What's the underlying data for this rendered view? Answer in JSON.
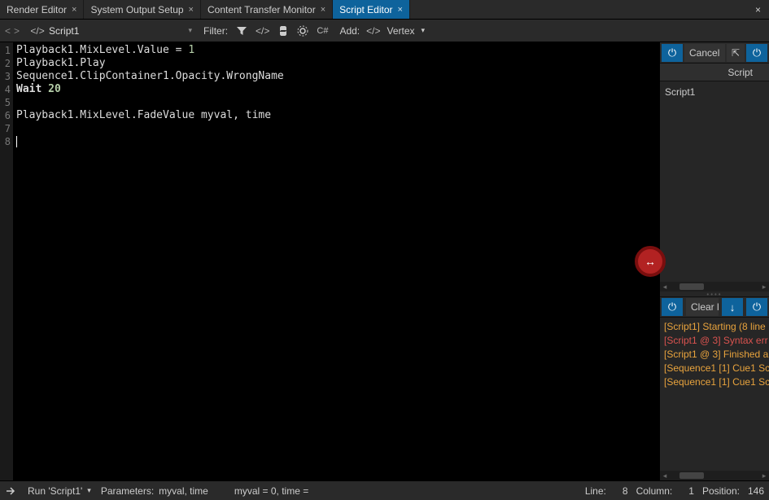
{
  "tabs": [
    {
      "label": "Render Editor",
      "active": false
    },
    {
      "label": "System Output Setup",
      "active": false
    },
    {
      "label": "Content Transfer Monitor",
      "active": false
    },
    {
      "label": "Script Editor",
      "active": true
    }
  ],
  "toolbar": {
    "script_name": "Script1",
    "filter_label": "Filter:",
    "cs_label": "C#",
    "add_label": "Add:",
    "add_target": "Vertex"
  },
  "editor": {
    "line_numbers": [
      "1",
      "2",
      "3",
      "4",
      "5",
      "6",
      "7",
      "8"
    ],
    "lines": [
      {
        "segs": [
          {
            "t": "Playback1.MixLevel.Value = "
          },
          {
            "t": "1",
            "cls": "kw-num"
          }
        ]
      },
      {
        "segs": [
          {
            "t": "Playback1.Play"
          }
        ]
      },
      {
        "segs": [
          {
            "t": "Sequence1.ClipContainer1.Opacity.WrongName"
          }
        ]
      },
      {
        "segs": [
          {
            "t": "Wait ",
            "cls": "kw-bold"
          },
          {
            "t": "20",
            "cls": "kw-num kw-bold"
          }
        ]
      },
      {
        "segs": [
          {
            "t": ""
          }
        ]
      },
      {
        "segs": [
          {
            "t": "Playback1.MixLevel.FadeValue myval, time"
          }
        ]
      },
      {
        "segs": [
          {
            "t": ""
          }
        ]
      },
      {
        "segs": [
          {
            "t": ""
          }
        ],
        "cursor": true
      }
    ]
  },
  "right_panel": {
    "cancel_label": "Cancel",
    "header": "Script",
    "scripts": [
      "Script1"
    ],
    "clear_label": "Clear lo",
    "log": [
      {
        "text": "[Script1] Starting (8 line",
        "cls": "log-orange"
      },
      {
        "text": "[Script1 @ 3] Syntax err",
        "cls": "log-red"
      },
      {
        "text": "[Script1 @ 3] Finished a",
        "cls": "log-orange"
      },
      {
        "text": "[Sequence1 [1] Cue1 Sc",
        "cls": "log-orange"
      },
      {
        "text": "[Sequence1 [1] Cue1 Sc",
        "cls": "log-orange"
      }
    ]
  },
  "status": {
    "run_label": "Run 'Script1'",
    "params_label": "Parameters:",
    "params_value": "myval, time",
    "vars": "myval = 0, time =",
    "line_label": "Line:",
    "line_val": "8",
    "col_label": "Column:",
    "col_val": "1",
    "pos_label": "Position:",
    "pos_val": "146"
  },
  "icons": {
    "code": "</>",
    "close": "×",
    "caret_down": "▾",
    "caret_right": "▸",
    "caret_left": "◂",
    "power": "⏻",
    "pin": "⇱",
    "down_arrow": "↓",
    "resize": "↔"
  }
}
